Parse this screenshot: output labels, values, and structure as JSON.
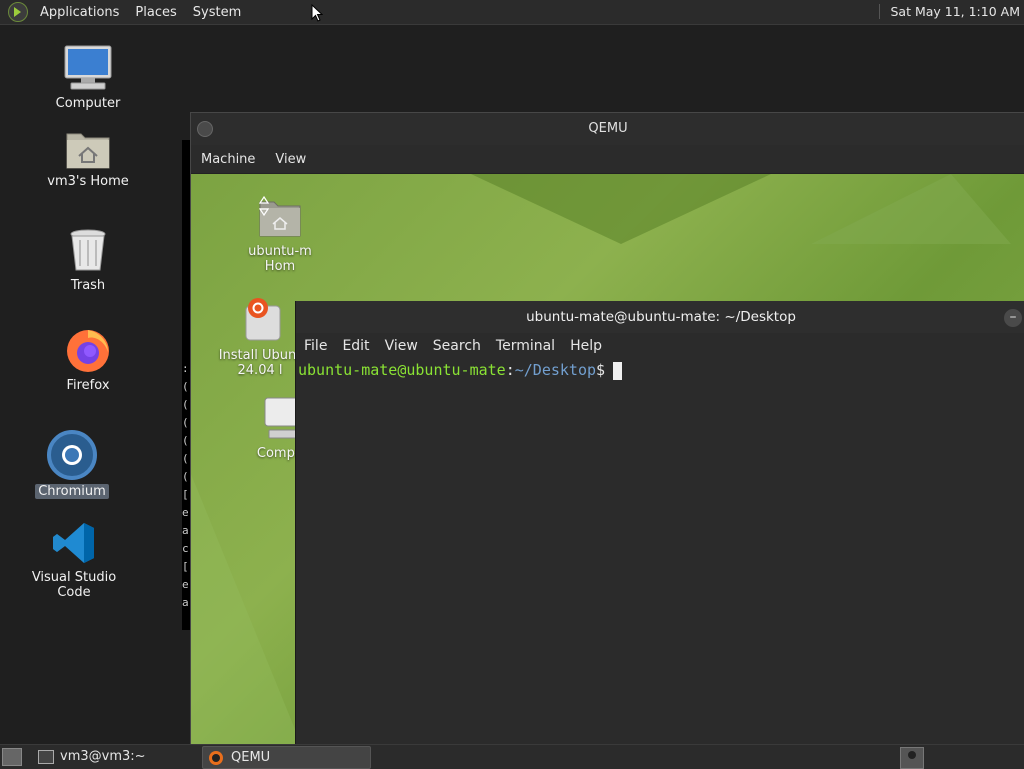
{
  "top_panel": {
    "menus": [
      "Applications",
      "Places",
      "System"
    ],
    "clock": "Sat May 11,  1:10 AM"
  },
  "desktop_icons": [
    {
      "label": "Computer",
      "icon": "computer-icon"
    },
    {
      "label": "vm3's Home",
      "icon": "home-folder-icon"
    },
    {
      "label": "Trash",
      "icon": "trash-icon"
    },
    {
      "label": "Firefox",
      "icon": "firefox-icon"
    },
    {
      "label": "Chromium",
      "icon": "chromium-icon",
      "selected": true
    },
    {
      "label": "Visual Studio Code",
      "icon": "vscode-icon"
    }
  ],
  "qemu": {
    "title": "QEMU",
    "menu": [
      "Machine",
      "View"
    ],
    "guest_icons": [
      {
        "label_line1": "ubuntu-m",
        "label_line2": "Hom",
        "icon": "home-folder-icon"
      },
      {
        "label_line1": "Install Ubunt",
        "label_line2": "24.04 l",
        "icon": "installer-icon"
      },
      {
        "label_line1": "Compu",
        "label_line2": "",
        "icon": "computer-icon"
      }
    ]
  },
  "terminal": {
    "title": "ubuntu-mate@ubuntu-mate: ~/Desktop",
    "menu": [
      "File",
      "Edit",
      "View",
      "Search",
      "Terminal",
      "Help"
    ],
    "prompt_user": "ubuntu-mate@ubuntu-mate",
    "prompt_colon": ":",
    "prompt_path": "~/Desktop",
    "prompt_symbol": "$"
  },
  "host_strip_chars": [
    ":",
    "(",
    "(",
    "(",
    "(",
    "(",
    "(",
    "[",
    "e",
    "a",
    "c",
    "[",
    "e",
    "a"
  ],
  "bottom_panel": {
    "tasks": [
      {
        "label": "vm3@vm3:~",
        "active": false
      },
      {
        "label": "QEMU",
        "active": true
      }
    ]
  },
  "colors": {
    "prompt_user": "#8ae234",
    "prompt_path": "#729fcf",
    "guest_wallpaper": "#7ca342"
  }
}
